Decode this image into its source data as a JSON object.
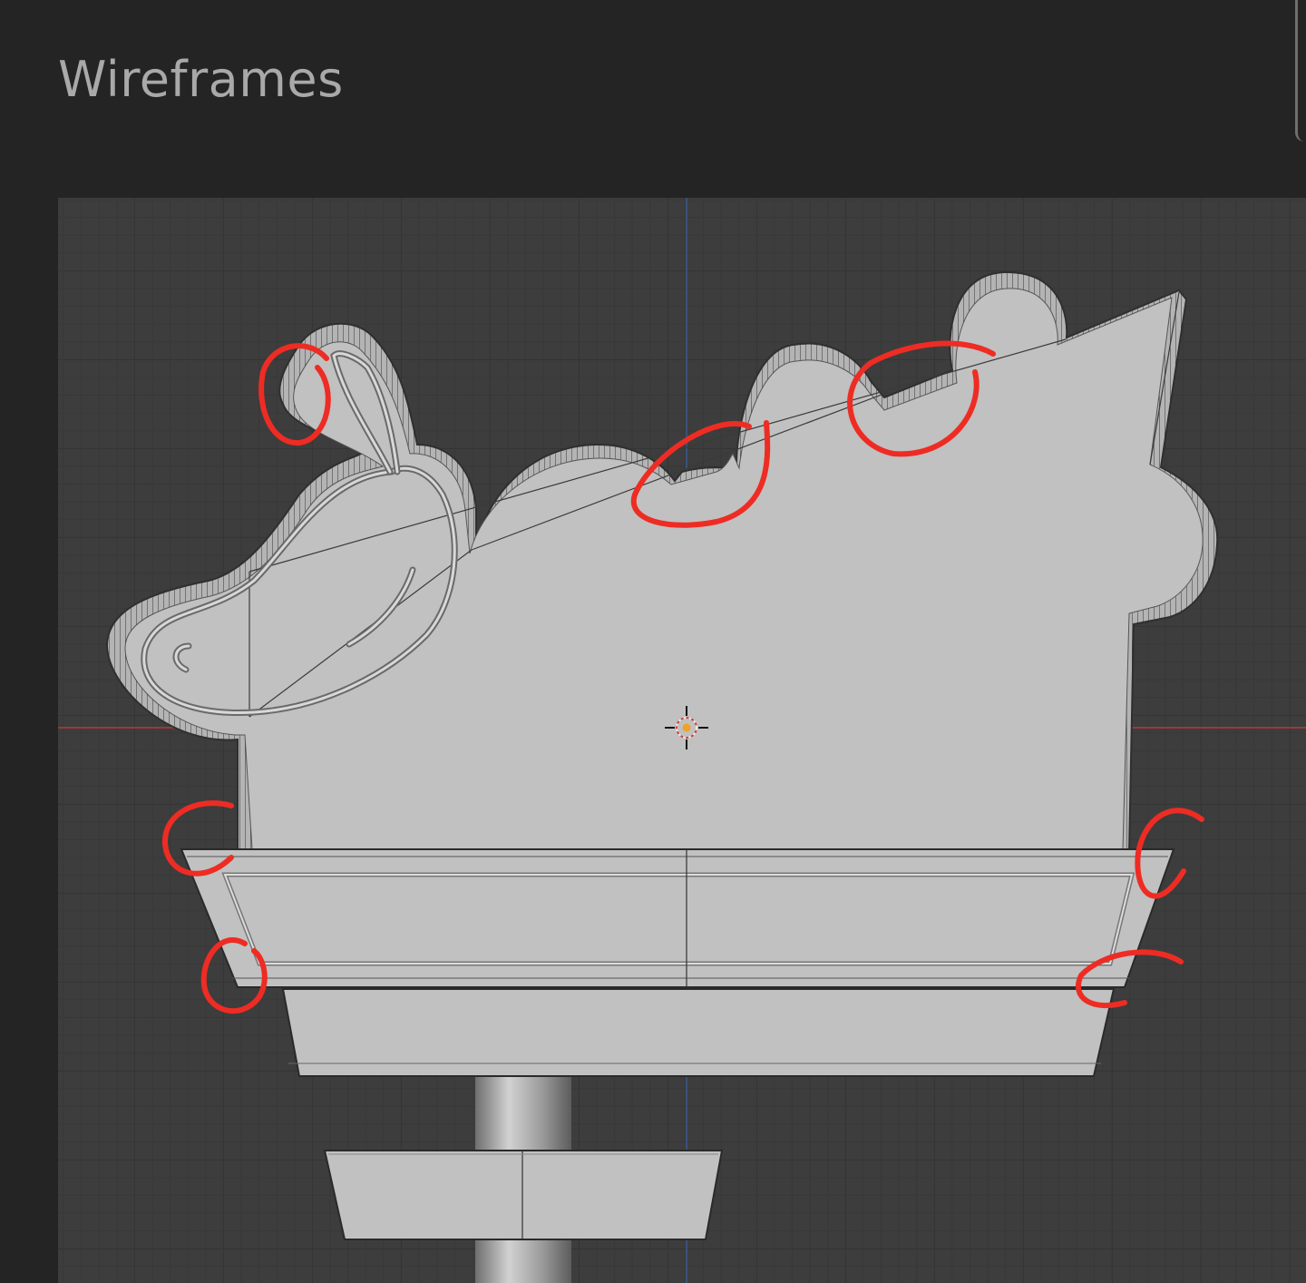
{
  "header": {
    "title": "Wireframes"
  },
  "viewport": {
    "background_color": "#3d3d3d",
    "x_axis_color": "#b93838",
    "y_axis_color": "#3b5b8f",
    "mesh_color": "#c0c1c0",
    "annotation_color": "#ee2c24"
  },
  "icons": {
    "origin": "3d-cursor-icon"
  }
}
